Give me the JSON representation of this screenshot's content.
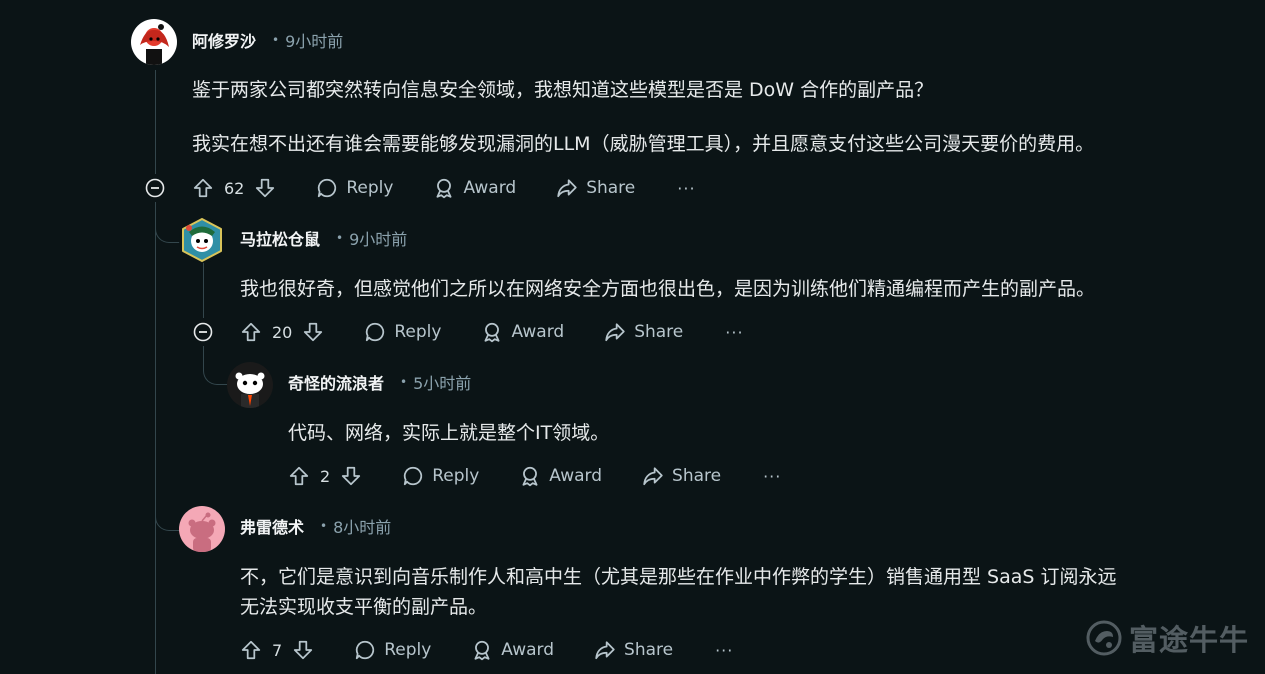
{
  "comments": [
    {
      "author": "阿修罗沙",
      "time": "9小时前",
      "lines": [
        "鉴于两家公司都突然转向信息安全领域，我想知道这些模型是否是 DoW 合作的副产品？",
        "我实在想不出还有谁会需要能够发现漏洞的LLM（威胁管理工具），并且愿意支付这些公司漫天要价的费用。"
      ],
      "score": "62"
    },
    {
      "author": "马拉松仓鼠",
      "time": "9小时前",
      "lines": [
        "我也很好奇，但感觉他们之所以在网络安全方面也很出色，是因为训练他们精通编程而产生的副产品。"
      ],
      "score": "20"
    },
    {
      "author": "奇怪的流浪者",
      "time": "5小时前",
      "lines": [
        "代码、网络，实际上就是整个IT领域。"
      ],
      "score": "2"
    },
    {
      "author": "弗雷德术",
      "time": "8小时前",
      "lines": [
        "不，它们是意识到向音乐制作人和高中生（尤其是那些在作业中作弊的学生）销售通用型 SaaS 订阅永远",
        "无法实现收支平衡的副产品。"
      ],
      "score": "7"
    }
  ],
  "actions": {
    "reply": "Reply",
    "award": "Award",
    "share": "Share",
    "more": "···"
  },
  "watermark": {
    "text": "富途牛牛"
  },
  "colors": {
    "background": "#0b1416",
    "text": "#f2f4f5",
    "muted": "#8ba2ad",
    "thread": "#33464c"
  }
}
